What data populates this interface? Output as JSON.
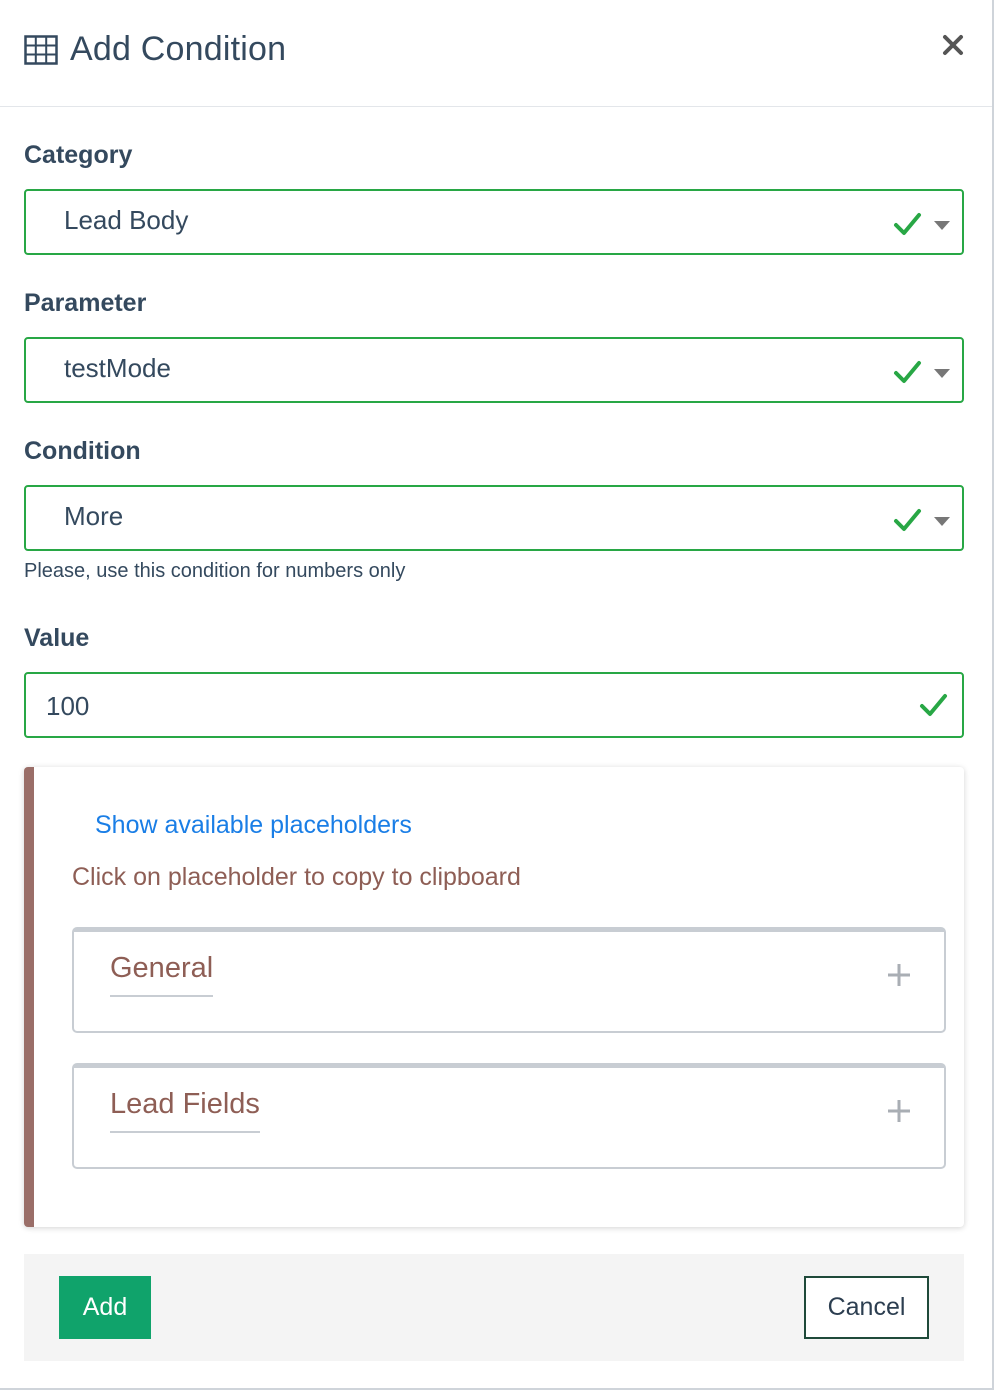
{
  "modal": {
    "title": "Add Condition",
    "title_icon": "table-grid-icon",
    "close_icon": "close-icon"
  },
  "form": {
    "category": {
      "label": "Category",
      "value": "Lead Body",
      "status_icon": "check-icon"
    },
    "parameter": {
      "label": "Parameter",
      "value": "testMode",
      "status_icon": "check-icon"
    },
    "condition": {
      "label": "Condition",
      "value": "More",
      "hint": "Please, use this condition for numbers only",
      "status_icon": "check-icon"
    },
    "value": {
      "label": "Value",
      "value": "100",
      "status_icon": "check-icon"
    }
  },
  "placeholders": {
    "link": "Show available placeholders",
    "note": "Click on placeholder to copy to clipboard",
    "groups": [
      {
        "title": "General",
        "icon": "plus-icon"
      },
      {
        "title": "Lead Fields",
        "icon": "plus-icon"
      }
    ]
  },
  "footer": {
    "add_label": "Add",
    "cancel_label": "Cancel"
  },
  "colors": {
    "valid_border": "#28a745",
    "add_button": "#10a36b",
    "panel_accent": "#9a6e68",
    "link": "#1a7ee6"
  }
}
